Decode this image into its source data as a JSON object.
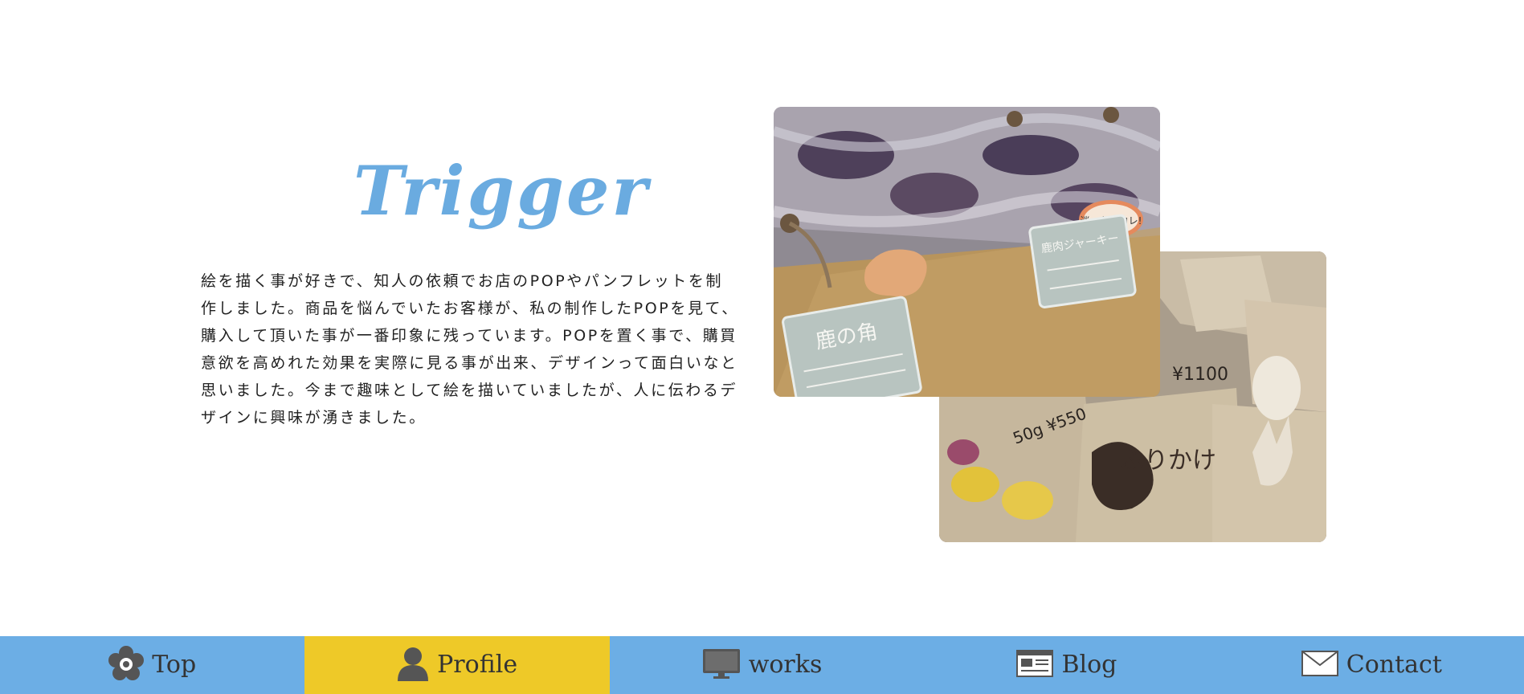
{
  "section": {
    "title": "Trigger",
    "paragraph": "絵を描く事が好きで、知人の依頼でお店のPOPやパンフレットを制作しました。商品を悩んでいたお客様が、私の制作したPOPを見て、購入して頂いた事が一番印象に残っています。POPを置く事で、購買意欲を高めれた効果を実際に見る事が出来、デザインって面白いなと思いました。今まで趣味として絵を描いていましたが、人に伝わるデザインに興味が湧きました。"
  },
  "photos": {
    "front": {
      "pop_card_1": "鹿の角",
      "pop_card_2": "鹿肉ジャーキー",
      "speech_bubble": "迷ったらコレ!"
    },
    "back": {
      "card_text_1": "ふりかけ",
      "card_text_2": "¥1100",
      "card_text_3": "50g ¥550"
    }
  },
  "nav": {
    "items": [
      {
        "label": "Top",
        "icon": "flower-icon",
        "active": false
      },
      {
        "label": "Profile",
        "icon": "person-icon",
        "active": true
      },
      {
        "label": "works",
        "icon": "monitor-icon",
        "active": false
      },
      {
        "label": "Blog",
        "icon": "newspaper-icon",
        "active": false
      },
      {
        "label": "Contact",
        "icon": "envelope-icon",
        "active": false
      }
    ]
  },
  "colors": {
    "title": "#6aabe0",
    "nav_background": "#6caee5",
    "nav_active": "#eec928",
    "icon": "#555555"
  }
}
